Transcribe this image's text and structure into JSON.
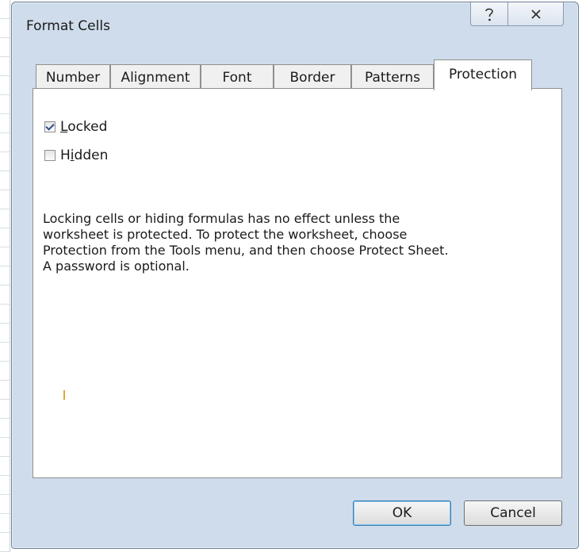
{
  "dialog": {
    "title": "Format Cells",
    "help_icon": "question-mark-icon",
    "close_icon": "close-icon"
  },
  "tabs": [
    {
      "label": "Number"
    },
    {
      "label": "Alignment"
    },
    {
      "label": "Font"
    },
    {
      "label": "Border"
    },
    {
      "label": "Patterns"
    },
    {
      "label": "Protection",
      "active": true
    }
  ],
  "protection": {
    "locked": {
      "label_prefix": "",
      "label_underline": "L",
      "label_rest": "ocked",
      "checked": true
    },
    "hidden": {
      "label_prefix": "H",
      "label_underline": "i",
      "label_rest": "dden",
      "checked": false
    },
    "description": "Locking cells or hiding formulas has no effect unless the worksheet is protected. To protect the worksheet, choose Protection from the Tools menu, and then choose Protect Sheet. A password is optional."
  },
  "buttons": {
    "ok_label": "OK",
    "cancel_label": "Cancel"
  }
}
